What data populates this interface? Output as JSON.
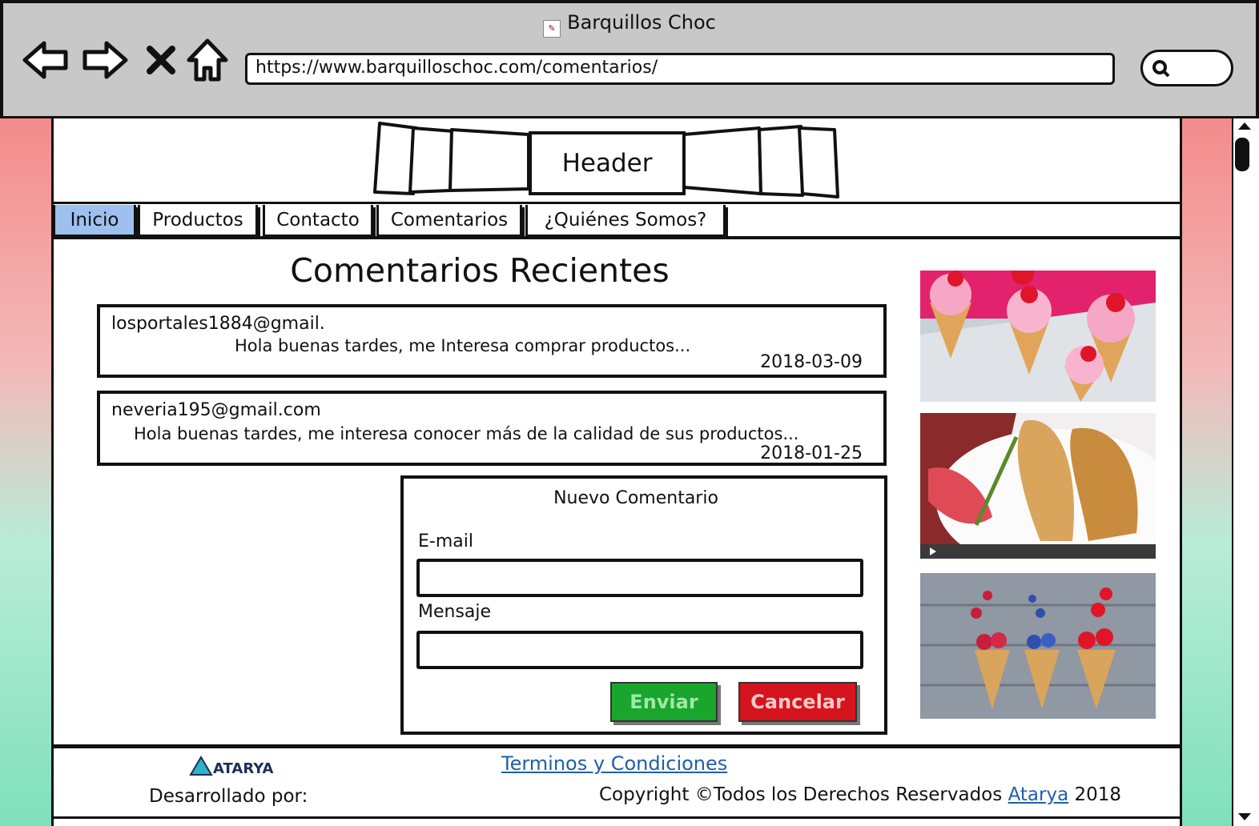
{
  "window": {
    "title": "Barquillos Choc"
  },
  "toolbar": {
    "url": "https://www.barquilloschoc.com/comentarios/"
  },
  "header": {
    "label": "Header"
  },
  "nav": {
    "tabs": [
      "Inicio",
      "Productos",
      "Contacto",
      "Comentarios",
      "¿Quiénes Somos?"
    ],
    "active": "Inicio"
  },
  "main": {
    "title": "Comentarios Recientes",
    "comments": [
      {
        "email": "losportales1884@gmail.",
        "text": "Hola buenas tardes, me Interesa comprar productos...",
        "date": "2018-03-09"
      },
      {
        "email": "neveria195@gmail.com",
        "text": "Hola buenas tardes, me interesa conocer más de la calidad de sus productos...",
        "date": "2018-01-25"
      }
    ]
  },
  "form": {
    "title": "Nuevo Comentario",
    "email_label": "E-mail",
    "message_label": "Mensaje",
    "send_label": "Enviar",
    "cancel_label": "Cancelar"
  },
  "footer": {
    "terms_link": "Terminos y Condiciones",
    "dev_label": "Desarrollado por:",
    "logo_text": "ATARYA",
    "copyright_prefix": "Copyright",
    "copyright_text": "Todos los Derechos Reservados",
    "company_link": "Atarya",
    "year": "2018"
  },
  "colors": {
    "active_tab": "#9ec0ef",
    "send": "#1aa52c",
    "cancel": "#d5141d",
    "link": "#1f5fa8"
  }
}
